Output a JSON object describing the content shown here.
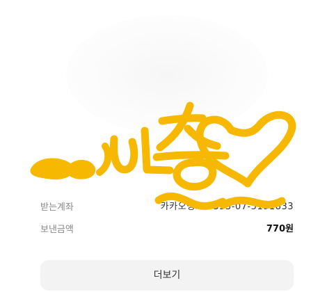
{
  "transfer": {
    "receiving_account_label": "받는계좌",
    "receiving_account_value": "카카오뱅크 3333-07-5191833",
    "send_amount_label": "보낸금액",
    "send_amount_value": "770원"
  },
  "actions": {
    "more_label": "더보기"
  },
  "annotation": {
    "handwritten_text": "인증",
    "color": "#f6b800"
  }
}
